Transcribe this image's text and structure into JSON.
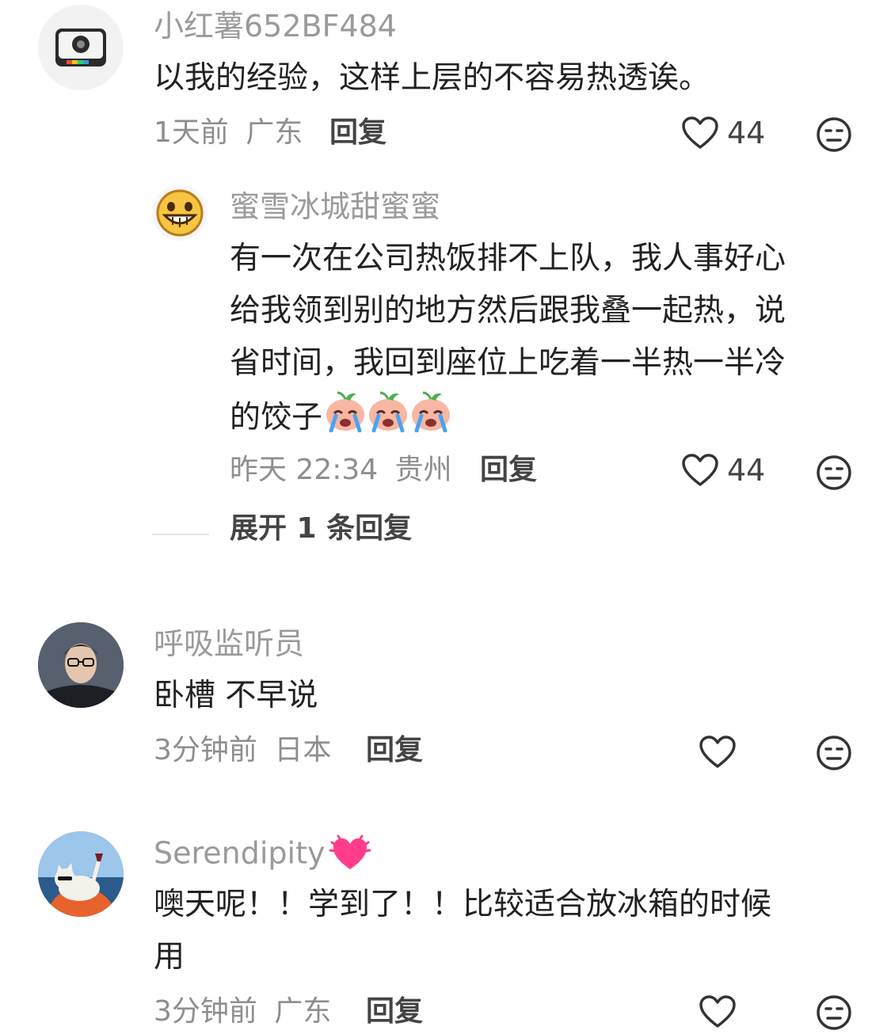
{
  "comments": [
    {
      "username": "小红薯652BF484",
      "text": "以我的经验，这样上层的不容易热透诶。",
      "time": "1天前",
      "location": "广东",
      "reply_label": "回复",
      "likes": "44",
      "avatar_icon": "camera-icon"
    },
    {
      "username": "蜜雪冰城甜蜜蜜",
      "text_lines": [
        "有一次在公司热饭排不上队，我人事好心",
        "给我领到别的地方然后跟我叠一起热，说",
        "省时间，我回到座位上吃着一半热一半冷",
        "的饺子"
      ],
      "time": "昨天 22:34",
      "location": "贵州",
      "reply_label": "回复",
      "likes": "44",
      "avatar_icon": "grinning-face-icon",
      "emoji_icon": "crying-peach-icon"
    },
    {
      "username": "呼吸监听员",
      "text": "卧槽 不早说",
      "time": "3分钟前",
      "location": "日本",
      "reply_label": "回复",
      "likes": "",
      "avatar_icon": "person-photo-icon"
    },
    {
      "username": "Serendipity",
      "text_lines": [
        "噢天呢！！学到了！！比较适合放冰箱的时候",
        "用"
      ],
      "time": "3分钟前",
      "location": "广东",
      "reply_label": "回复",
      "likes": "",
      "avatar_icon": "cat-photo-icon",
      "name_emoji_icon": "growing-heart-icon"
    }
  ],
  "expand_replies": "展开 1 条回复",
  "colors": {
    "name": "#9a9a9a",
    "text": "#222222",
    "meta": "#8e8e8e",
    "reply": "#444444"
  }
}
